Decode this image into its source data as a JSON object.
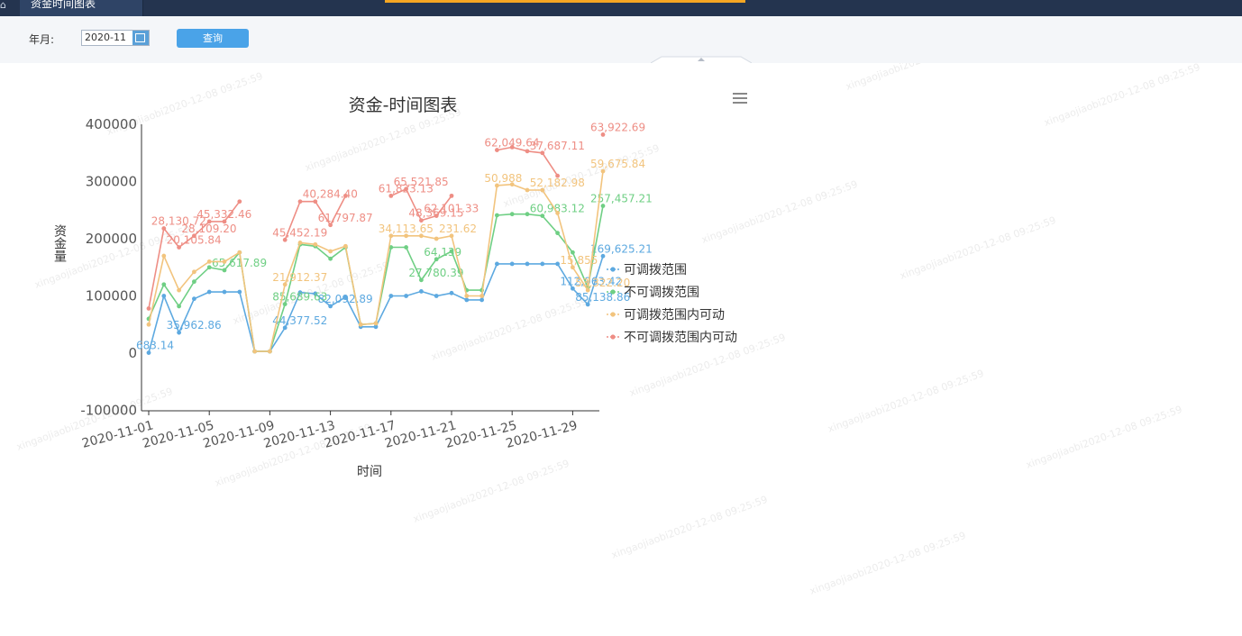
{
  "header": {
    "tab_title": "资金时间图表"
  },
  "filter": {
    "year_month_label": "年月:",
    "date_value": "2020-11",
    "query_button": "查询"
  },
  "watermark": "xingaojiaobi2020-12-08 09:25:59",
  "chart_data": {
    "type": "line",
    "title": "资金-时间图表",
    "xlabel": "时间",
    "ylabel": "资金量",
    "ylim": [
      -100000,
      400000
    ],
    "y_ticks": [
      "400000",
      "300000",
      "200000",
      "100000",
      "0",
      "-100000"
    ],
    "x_tick_labels": [
      "2020-11-01",
      "2020-11-05",
      "2020-11-09",
      "2020-11-13",
      "2020-11-17",
      "2020-11-21",
      "2020-11-25",
      "2020-11-29"
    ],
    "x": [
      "2020-11-01",
      "2020-11-02",
      "2020-11-03",
      "2020-11-04",
      "2020-11-05",
      "2020-11-06",
      "2020-11-07",
      "2020-11-08",
      "2020-11-09",
      "2020-11-10",
      "2020-11-11",
      "2020-11-12",
      "2020-11-13",
      "2020-11-14",
      "2020-11-15",
      "2020-11-16",
      "2020-11-17",
      "2020-11-18",
      "2020-11-19",
      "2020-11-20",
      "2020-11-21",
      "2020-11-22",
      "2020-11-23",
      "2020-11-24",
      "2020-11-25",
      "2020-11-26",
      "2020-11-27",
      "2020-11-28",
      "2020-11-29",
      "2020-11-30",
      "2020-12-01"
    ],
    "legend_position": "right",
    "grid": false,
    "series": [
      {
        "name": "可调拨范围",
        "color": "#5da9e0",
        "values": [
          683.14,
          100000,
          35962.86,
          95000,
          107000,
          107000,
          107000,
          3000,
          3000,
          44377.52,
          106000,
          104000,
          82092.89,
          98000,
          46000,
          46000,
          100000,
          100000,
          108000,
          100000,
          105000,
          93000,
          93000,
          156000,
          156000,
          156000,
          156000,
          156000,
          112963.42,
          85138.86,
          169625.21
        ],
        "labels": [
          "683.14",
          "",
          "35,962.86",
          "",
          "",
          "",
          "",
          "",
          "",
          "44,377.52",
          "",
          "",
          "82,092.89",
          "",
          "",
          "",
          "",
          "",
          "",
          "",
          "",
          "",
          "",
          "",
          "",
          "",
          "",
          "",
          "112,963.42",
          "85,138.86",
          "169,625.21"
        ]
      },
      {
        "name": "不可调拨范围",
        "color": "#6fcf84",
        "values": [
          60000,
          120000,
          82000,
          125000,
          150000,
          145000,
          176000,
          3000,
          3000,
          85689.63,
          190000,
          187000,
          165000,
          185000,
          50000,
          52000,
          185000,
          185000,
          127780.39,
          164139,
          178000,
          110000,
          110000,
          241000,
          243000,
          243000,
          240000,
          210000,
          176000,
          115000,
          257457.21
        ],
        "labels": [
          "",
          "",
          "",
          "",
          "",
          "65,617.89",
          "",
          "",
          "",
          "85,689.63",
          "",
          "",
          "",
          "",
          "",
          "",
          "",
          "",
          "27,780.39",
          "64,139",
          "",
          "",
          "",
          "",
          "",
          "",
          "60,983.12",
          "",
          "",
          "",
          "257,457.21"
        ]
      },
      {
        "name": "可调拨范围内可动",
        "color": "#f2c47e",
        "values": [
          50000,
          170000,
          110000,
          142000,
          160000,
          160000,
          176000,
          3000,
          3000,
          120000,
          193000,
          190000,
          178000,
          187000,
          50000,
          52000,
          205000,
          205000,
          205000,
          200000,
          205000,
          100000,
          100000,
          293000,
          295000,
          285000,
          285000,
          245000,
          150000,
          110000,
          318000
        ],
        "labels": [
          "",
          "",
          "",
          "",
          "",
          "",
          "",
          "",
          "",
          "21,912.37",
          "",
          "",
          "",
          "",
          "",
          "",
          "34,113.65",
          "",
          "",
          "",
          "231.62",
          "",
          "",
          "50,988",
          "",
          "",
          "52,182.98",
          "",
          "15,855",
          "53,322.20",
          "59,675.84"
        ]
      },
      {
        "name": "不可调拨范围内可动",
        "color": "#ee8e85",
        "values": [
          78000,
          218000,
          185000,
          205000,
          230000,
          230000,
          265000,
          null,
          null,
          198000,
          265000,
          265000,
          224000,
          275000,
          null,
          null,
          275000,
          287000,
          232000,
          240000,
          275000,
          null,
          null,
          355000,
          360000,
          353000,
          350000,
          310000,
          null,
          null,
          382000
        ],
        "labels": [
          "",
          "28,130.72",
          "20,105.84",
          "28,109.20",
          "45,332.46",
          "",
          "",
          "",
          "",
          "45,452.19",
          "",
          "40,284.40",
          "61,797.87",
          "",
          "",
          "",
          "61,823.13",
          "65,521.85",
          "48,369.15",
          "62,101.33",
          "",
          "",
          "",
          "62,049.64",
          "",
          "",
          "37,687.11",
          "",
          "",
          "",
          "63,922.69"
        ]
      }
    ]
  }
}
